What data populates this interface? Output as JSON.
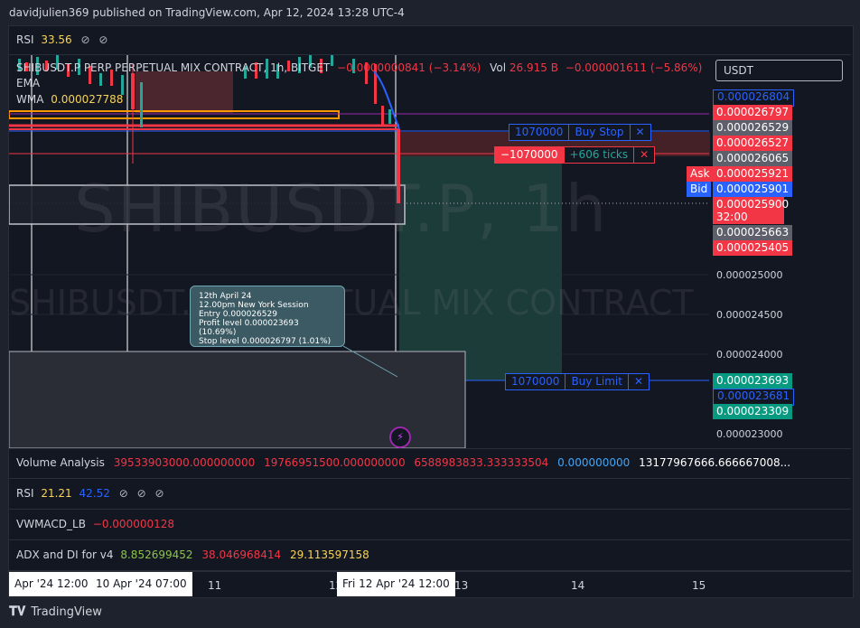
{
  "header": {
    "published": "davidjulien369 published on TradingView.com, Apr 12, 2024 13:28 UTC-4"
  },
  "top_indicator": {
    "name": "RSI",
    "value": "33.56"
  },
  "symbol": {
    "title": "SHIBUSDT.P PERP PERPETUAL MIX CONTRACT, 1h, BITGET",
    "change": "−0.0000000841 (−3.14%)",
    "vol_label": "Vol",
    "vol_value": "26.915 B",
    "vol_change": "−0.000001611 (−5.86%)",
    "ema_label": "EMA",
    "wma_label": "WMA",
    "wma_value": "0.000027788"
  },
  "currency_select": "USDT",
  "watermark": {
    "big": "SHIBUSDT.P, 1h",
    "sub": "SHIBUSDT.P PERPETUAL MIX CONTRACT"
  },
  "orders": {
    "buy_stop": {
      "qty": "1070000",
      "label": "Buy Stop",
      "close": "✕"
    },
    "position": {
      "qty": "−1070000",
      "ticks": "+606 ticks",
      "close": "✕"
    },
    "buy_limit": {
      "qty": "1070000",
      "label": "Buy Limit",
      "close": "✕"
    }
  },
  "price_axis": {
    "p1": "0.000026804",
    "p2": "0.000026797",
    "p3": "0.000026529",
    "p4": "0.000026527",
    "p5": "0.000026065",
    "ask_label": "Ask",
    "ask": "0.000025921",
    "bid_label": "Bid",
    "bid": "0.000025901",
    "last": "0.000025900",
    "countdown": "32:00",
    "p6": "0.000025663",
    "p7": "0.000025405",
    "g1": "0.000025000",
    "g2": "0.000024500",
    "g3": "0.000024000",
    "p8": "0.000023693",
    "p9": "0.000023681",
    "p10": "0.000023309",
    "g4": "0.000023000"
  },
  "tooltip": {
    "line1": "12th April 24",
    "line2": "12.00pm New York Session",
    "line3": "Entry 0.000026529",
    "line4": "Profit level 0.000023693 (10.69%)",
    "line5": "Stop level 0.000026797 (1.01%)"
  },
  "volume_analysis": {
    "name": "Volume Analysis",
    "v1": "39533903000.000000000",
    "v2": "19766951500.000000000",
    "v3": "6588983833.333333504",
    "v4": "0.000000000",
    "v5": "13177967666.666667008..."
  },
  "rsi2": {
    "name": "RSI",
    "v1": "21.21",
    "v2": "42.52"
  },
  "vwmacd": {
    "name": "VWMACD_LB",
    "v1": "−0.000000128"
  },
  "adx": {
    "name": "ADX and DI for v4",
    "v1": "8.852699452",
    "v2": "38.046968414",
    "v3": "29.113597158"
  },
  "time_axis": {
    "t1": "Apr '24   12:00",
    "t2": "10 Apr '24   07:00",
    "t3": "11",
    "t4": "12",
    "t5": "Fri 12 Apr '24   12:00",
    "t6": "13",
    "t7": "14",
    "t8": "15"
  },
  "footer": {
    "brand": "TradingView"
  },
  "colors": {
    "up": "#26a69a",
    "down": "#f23645",
    "blue": "#2962ff",
    "bg": "#131722"
  }
}
